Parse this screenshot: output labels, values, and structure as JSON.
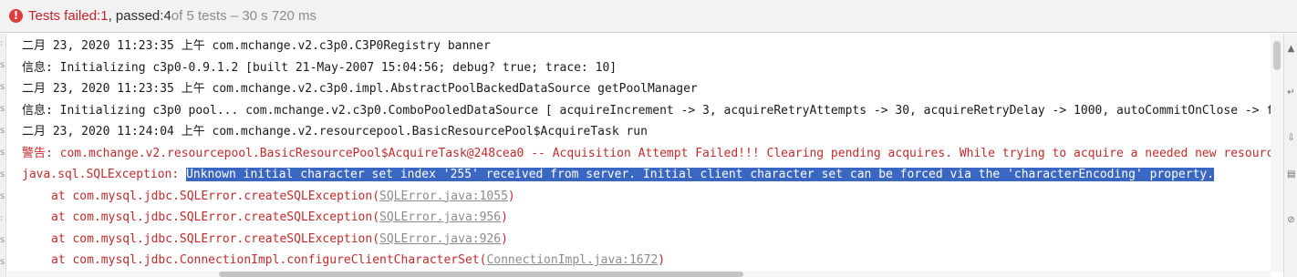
{
  "status": {
    "failed_label": "Tests failed: ",
    "failed_count": "1",
    "passed_label": ", passed: ",
    "passed_count": "4",
    "total": " of 5 tests – 30 s 720 ms"
  },
  "gutter_marks": [
    ":",
    "s",
    "s",
    "s",
    "s",
    "s",
    "s",
    "s",
    ":",
    "s",
    "s"
  ],
  "console": {
    "lines": [
      "二月 23, 2020 11:23:35 上午 com.mchange.v2.c3p0.C3P0Registry banner",
      "信息: Initializing c3p0-0.9.1.2 [built 21-May-2007 15:04:56; debug? true; trace: 10]",
      "二月 23, 2020 11:23:35 上午 com.mchange.v2.c3p0.impl.AbstractPoolBackedDataSource getPoolManager",
      "信息: Initializing c3p0 pool... com.mchange.v2.c3p0.ComboPooledDataSource [ acquireIncrement -> 3, acquireRetryAttempts -> 30, acquireRetryDelay -> 1000, autoCommitOnClose -> fa",
      "二月 23, 2020 11:24:04 上午 com.mchange.v2.resourcepool.BasicResourcePool$AcquireTask run",
      "警告: com.mchange.v2.resourcepool.BasicResourcePool$AcquireTask@248cea0 -- Acquisition Attempt Failed!!! Clearing pending acquires. While trying to acquire a needed new resource"
    ],
    "exception_prefix": "java.sql.SQLException: ",
    "exception_message": "Unknown initial character set index '255' received from server. Initial client character set can be forced via the 'characterEncoding' property.",
    "stack": [
      {
        "text": "at com.mysql.jdbc.SQLError.createSQLException(",
        "link": "SQLError.java:1055",
        "close": ")"
      },
      {
        "text": "at com.mysql.jdbc.SQLError.createSQLException(",
        "link": "SQLError.java:956",
        "close": ")"
      },
      {
        "text": "at com.mysql.jdbc.SQLError.createSQLException(",
        "link": "SQLError.java:926",
        "close": ")"
      },
      {
        "text": "at com.mysql.jdbc.ConnectionImpl.configureClientCharacterSet(",
        "link": "ConnectionImpl.java:1672",
        "close": ")"
      }
    ]
  },
  "icons": {
    "status": "error-circle-icon",
    "tools": [
      "scroll-up-icon",
      "soft-wrap-icon",
      "scroll-to-end-icon",
      "print-icon",
      "clear-icon"
    ]
  },
  "colors": {
    "fail": "#c7222a",
    "selection": "#3a67c2",
    "error_text": "#c22b2b"
  }
}
